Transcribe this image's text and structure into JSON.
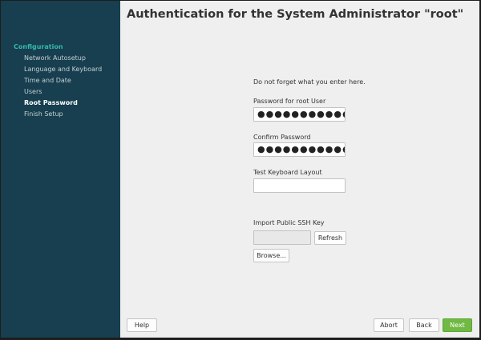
{
  "header": {
    "title": "Authentication for the System Administrator \"root\""
  },
  "sidebar": {
    "heading": "Configuration",
    "items": [
      {
        "label": "Network Autosetup"
      },
      {
        "label": "Language and Keyboard"
      },
      {
        "label": "Time and Date"
      },
      {
        "label": "Users"
      },
      {
        "label": "Root Password"
      },
      {
        "label": "Finish Setup"
      }
    ],
    "active_index": 4
  },
  "form": {
    "hint": "Do not forget what you enter here.",
    "password_label": "Password for root User",
    "password_value": "●●●●●●●●●●●●●●",
    "confirm_label": "Confirm Password",
    "confirm_value": "●●●●●●●●●●●●●●",
    "keyboard_label": "Test Keyboard Layout",
    "keyboard_value": "",
    "ssh_label": "Import Public SSH Key",
    "ssh_value": "",
    "refresh_label": "Refresh",
    "browse_label": "Browse..."
  },
  "footer": {
    "help_label": "Help",
    "abort_label": "Abort",
    "back_label": "Back",
    "next_label": "Next"
  },
  "colors": {
    "sidebar_bg": "#173f4f",
    "sidebar_heading": "#35b9ab",
    "next_button": "#70b944"
  }
}
